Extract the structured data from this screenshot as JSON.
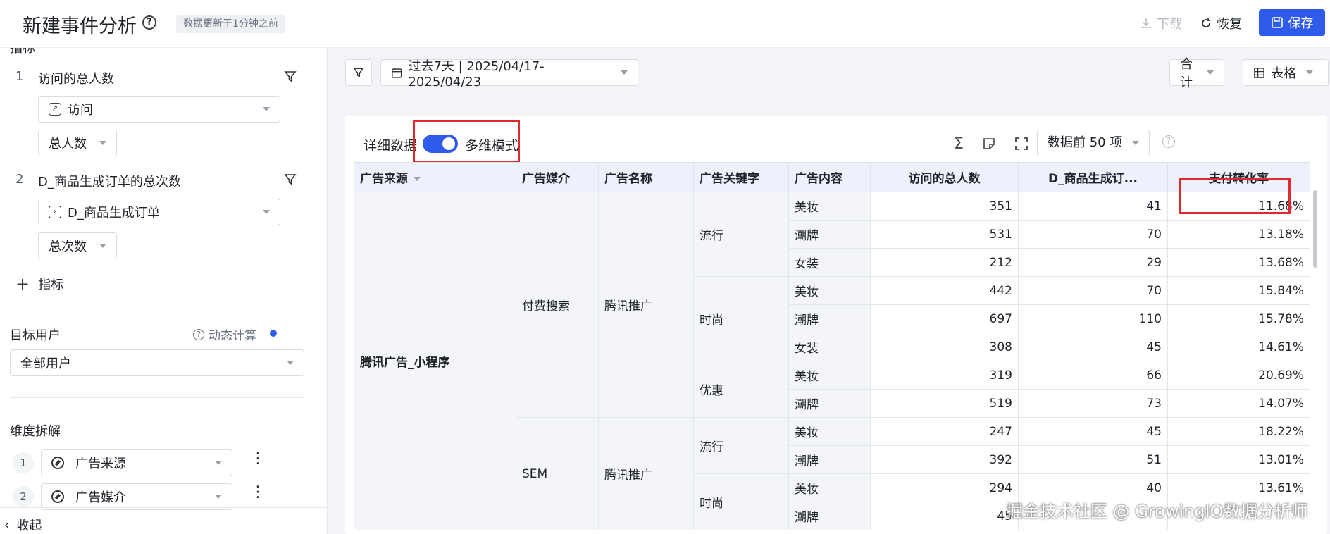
{
  "header": {
    "title": "新建事件分析",
    "update_status": "数据更新于1分钟之前",
    "download_label": "下载",
    "restore_label": "恢复",
    "save_label": "保存"
  },
  "sidebar": {
    "metrics_title": "指标",
    "metrics": [
      {
        "num": "1",
        "name": "访问的总人数",
        "event": "访问",
        "measure": "总人数"
      },
      {
        "num": "2",
        "name": "D_商品生成订单的总次数",
        "event": "D_商品生成订单",
        "measure": "总次数"
      }
    ],
    "add_metric_label": "指标",
    "target_users_title": "目标用户",
    "dynamic_calc_label": "动态计算",
    "target_users_value": "全部用户",
    "dimension_title": "维度拆解",
    "dimensions": [
      {
        "num": "1",
        "name": "广告来源"
      },
      {
        "num": "2",
        "name": "广告媒介"
      }
    ],
    "collapse_label": "收起"
  },
  "toolbar": {
    "date_range": "过去7天 | 2025/04/17-2025/04/23",
    "aggregate_label": "合计",
    "view_label": "表格"
  },
  "card": {
    "title": "详细数据",
    "mode_label": "多维模式",
    "topn_label": "数据前 50 项"
  },
  "table": {
    "headers": [
      "广告来源",
      "广告媒介",
      "广告名称",
      "广告关键字",
      "广告内容",
      "访问的总人数",
      "D_商品生成订...",
      "支付转化率"
    ],
    "source": "腾讯广告_小程序",
    "groups": [
      {
        "media": "付费搜索",
        "adname": "腾讯推广",
        "keywords": [
          {
            "keyword": "流行",
            "rows": [
              [
                "美妆",
                "351",
                "41",
                "11.68%"
              ],
              [
                "潮牌",
                "531",
                "70",
                "13.18%"
              ],
              [
                "女装",
                "212",
                "29",
                "13.68%"
              ]
            ]
          },
          {
            "keyword": "时尚",
            "rows": [
              [
                "美妆",
                "442",
                "70",
                "15.84%"
              ],
              [
                "潮牌",
                "697",
                "110",
                "15.78%"
              ],
              [
                "女装",
                "308",
                "45",
                "14.61%"
              ]
            ]
          },
          {
            "keyword": "优惠",
            "rows": [
              [
                "美妆",
                "319",
                "66",
                "20.69%"
              ],
              [
                "潮牌",
                "519",
                "73",
                "14.07%"
              ]
            ]
          }
        ]
      },
      {
        "media": "SEM",
        "adname": "腾讯推广",
        "keywords": [
          {
            "keyword": "流行",
            "rows": [
              [
                "美妆",
                "247",
                "45",
                "18.22%"
              ],
              [
                "潮牌",
                "392",
                "51",
                "13.01%"
              ]
            ]
          },
          {
            "keyword": "时尚",
            "rows": [
              [
                "美妆",
                "294",
                "40",
                "13.61%"
              ],
              [
                "潮牌",
                "45",
                "",
                ""
              ]
            ]
          }
        ]
      }
    ]
  },
  "watermark": "掘金技术社区 @ GrowingIO数据分析师",
  "colors": {
    "accent": "#2e5bea",
    "highlight_box": "#e0282e",
    "header_bg": "#edf1fb"
  }
}
